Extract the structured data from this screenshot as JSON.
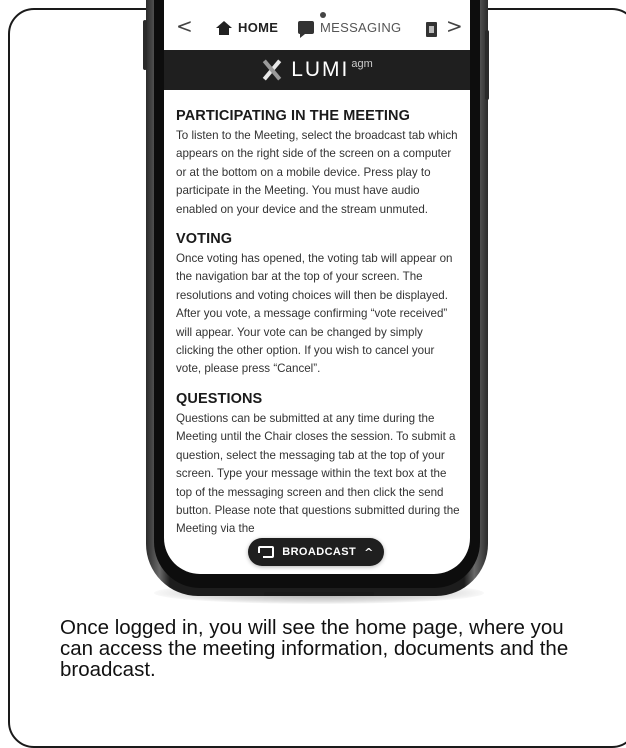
{
  "nav": {
    "back_arrow": "<",
    "forward_arrow": ">",
    "tabs": [
      {
        "label": "HOME",
        "icon": "home-icon"
      },
      {
        "label": "MESSAGING",
        "icon": "message-icon"
      }
    ],
    "docs_icon": "document-icon"
  },
  "brand": {
    "name": "LUMI",
    "suffix": "agm"
  },
  "sections": [
    {
      "title": "PARTICIPATING IN THE MEETING",
      "body": "To listen to the Meeting, select the broadcast tab which appears on the right side of the screen on a computer or at the bottom on a mobile device. Press play to participate in the Meeting. You must have audio enabled on your device and the stream unmuted."
    },
    {
      "title": "VOTING",
      "body": "Once voting has opened, the voting tab will appear on the navigation bar at the top of your screen. The resolutions and voting choices will then be displayed. After you vote, a message confirming “vote received” will appear. Your vote can be changed by simply clicking the other option. If you wish to cancel your vote, please press “Cancel”."
    },
    {
      "title": "QUESTIONS",
      "body": "Questions can be submitted at any time during the Meeting until the Chair closes the session. To submit a question, select the messaging tab at the top of your screen. Type your message within the text box at the top of the messaging screen and then click the send button. Please note that questions submitted during the Meeting via the"
    }
  ],
  "broadcast": {
    "label": "BROADCAST",
    "chevron": "^"
  },
  "caption": "Once logged in, you will see the home page, where you can access the meeting information, documents and the broadcast."
}
